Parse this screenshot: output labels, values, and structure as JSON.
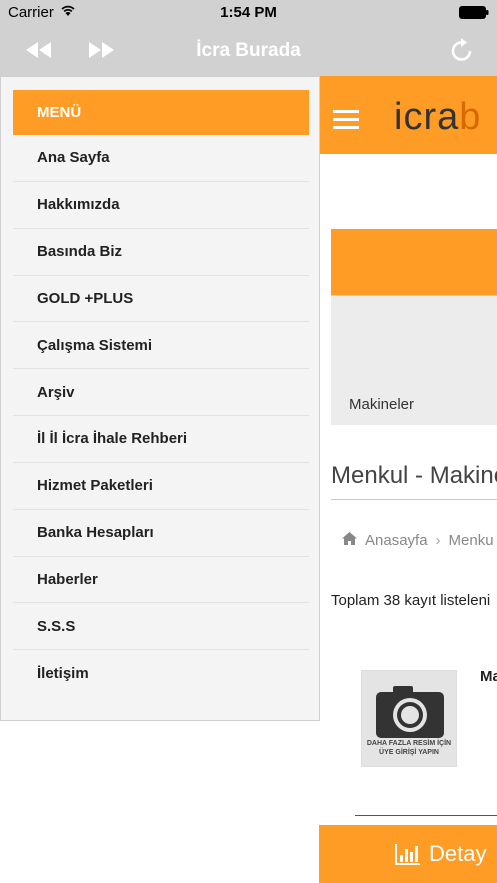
{
  "status_bar": {
    "carrier": "Carrier",
    "time": "1:54 PM"
  },
  "nav": {
    "title": "İcra Burada"
  },
  "site": {
    "logo_part1": "icra",
    "logo_part2": "b",
    "category_label": "Makineler",
    "heading": "Menkul - Makine",
    "breadcrumb_home": "Anasayfa",
    "breadcrumb_current": "Menku",
    "total_text": "Toplam 38 kayıt listeleni",
    "thumb_text_line1": "DAHA FAZLA RESİM İÇİN",
    "thumb_text_line2": "ÜYE GİRİŞİ YAPIN",
    "item_title": "Ma",
    "detail_button": "Detay"
  },
  "menu": {
    "header": "MENÜ",
    "items": [
      {
        "label": "Ana Sayfa"
      },
      {
        "label": "Hakkımızda"
      },
      {
        "label": "Basında Biz"
      },
      {
        "label": "GOLD +PLUS"
      },
      {
        "label": "Çalışma Sistemi"
      },
      {
        "label": "Arşiv"
      },
      {
        "label": "İl İl İcra İhale Rehberi"
      },
      {
        "label": "Hizmet Paketleri"
      },
      {
        "label": "Banka Hesapları"
      },
      {
        "label": "Haberler"
      },
      {
        "label": "S.S.S"
      },
      {
        "label": "İletişim"
      }
    ]
  },
  "colors": {
    "accent": "#ff9c25",
    "navbar": "#d1d1d1",
    "menu_bg": "#f4f4f4"
  }
}
